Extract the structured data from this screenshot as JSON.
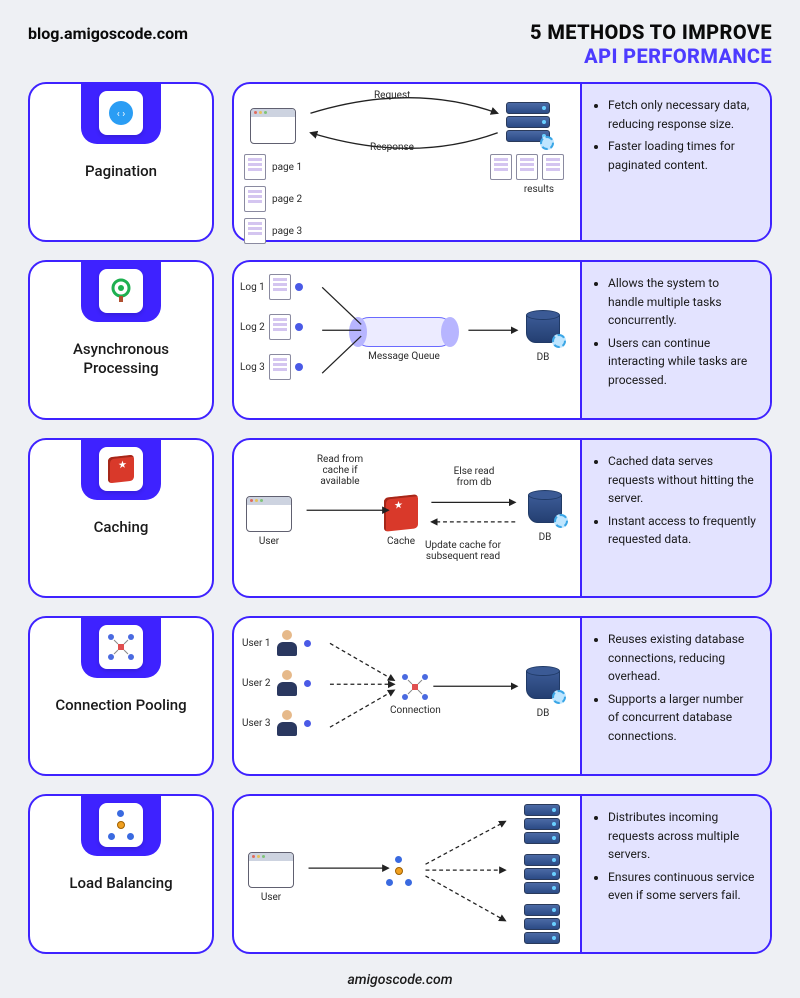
{
  "header": {
    "blog_url": "blog.amigoscode.com",
    "title_line1": "5 METHODS TO IMPROVE",
    "title_line2": "API PERFORMANCE"
  },
  "footer": "amigoscode.com",
  "methods": [
    {
      "name": "Pagination",
      "diagram": {
        "request": "Request",
        "response": "Response",
        "pages": [
          "page 1",
          "page 2",
          "page 3"
        ],
        "results": "results"
      },
      "bullets": [
        "Fetch only necessary data, reducing response size.",
        "Faster loading times for paginated content."
      ]
    },
    {
      "name": "Asynchronous Processing",
      "diagram": {
        "logs": [
          "Log 1",
          "Log 2",
          "Log 3"
        ],
        "queue": "Message Queue",
        "db": "DB"
      },
      "bullets": [
        "Allows the system to handle multiple tasks concurrently.",
        "Users can continue interacting while tasks are processed."
      ]
    },
    {
      "name": "Caching",
      "diagram": {
        "user": "User",
        "cache": "Cache",
        "db": "DB",
        "read_cache": "Read from cache if available",
        "else_read": "Else read from db",
        "update": "Update cache for subsequent read"
      },
      "bullets": [
        "Cached data serves requests without hitting the server.",
        "Instant access to frequently requested data."
      ]
    },
    {
      "name": "Connection Pooling",
      "diagram": {
        "users": [
          "User 1",
          "User 2",
          "User 3"
        ],
        "connection": "Connection",
        "db": "DB"
      },
      "bullets": [
        "Reuses existing database connections, reducing overhead.",
        "Supports a larger number of concurrent database connections."
      ]
    },
    {
      "name": "Load Balancing",
      "diagram": {
        "user": "User"
      },
      "bullets": [
        "Distributes incoming requests across multiple servers.",
        "Ensures continuous service even if some servers fail."
      ]
    }
  ]
}
